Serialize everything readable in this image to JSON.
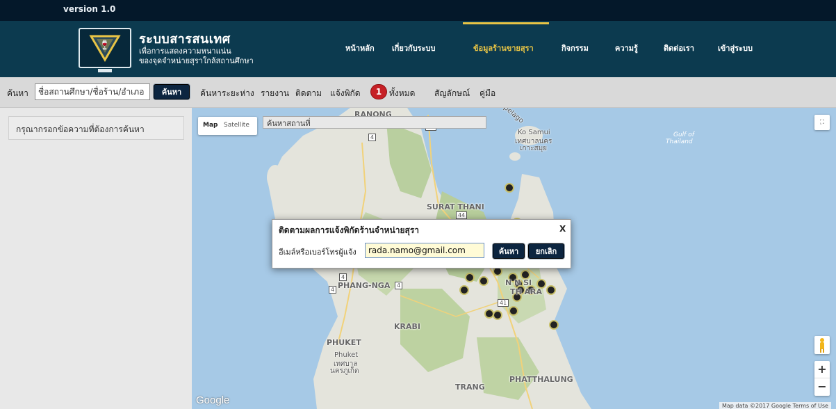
{
  "app": {
    "version": "version 1.0",
    "title": "ระบบสารสนเทศ",
    "subtitle_line1": "เพื่อการแสดงความหนาแน่น",
    "subtitle_line2": "ของจุดจำหน่ายสุราใกล้สถานศึกษา",
    "colors": {
      "header_bg": "#0c3a4f",
      "topbar_bg": "#04182a",
      "accent": "#e8c445",
      "button_dark": "#0c2540",
      "badge_red": "#c62026"
    }
  },
  "nav": {
    "items": [
      {
        "label": "หน้าหลัก",
        "active": false
      },
      {
        "label": "เกี่ยวกับระบบ",
        "active": false
      },
      {
        "label": "ข้อมูลร้านขายสุรา",
        "active": true
      },
      {
        "label": "กิจกรรม",
        "active": false
      },
      {
        "label": "ความรู้",
        "active": false
      },
      {
        "label": "ติดต่อเรา",
        "active": false
      },
      {
        "label": "เข้าสู่ระบบ",
        "active": false
      }
    ]
  },
  "toolbar": {
    "search_label": "ค้นหา",
    "search_value": "ชื่อสถานศึกษา/ชื่อร้าน/อำเภอ",
    "search_button": "ค้นหา",
    "links": [
      "ค้นหาระยะห่าง",
      "รายงาน",
      "ติดตาม",
      "แจ้งพิกัด"
    ],
    "notification_count": "1",
    "all_label": "ทั้งหมด",
    "legend_label": "สัญลักษณ์",
    "manual_label": "คู่มือ"
  },
  "left_panel": {
    "hint": "กรุณากรอกข้อความที่ต้องการค้นหา"
  },
  "map": {
    "type_map": "Map",
    "type_satellite": "Satellite",
    "place_search_value": "ค้นหาสถานที่",
    "labels": {
      "ranong": "RANONG",
      "surat": "SURAT THANI",
      "phangnga": "PHANG-NGA",
      "krabi": "KRABI",
      "phuket": "PHUKET",
      "phuket_city1": "Phuket",
      "phuket_city2": "เทศบาล",
      "phuket_city3": "นครภูเก็ต",
      "trang": "TRANG",
      "phatthalung": "PHATTHALUNG",
      "kosamui1": "Ko Samui",
      "kosamui2": "เทศบาลนคร",
      "kosamui3": "เกาะสมุย",
      "gulf1": "Gulf of",
      "gulf2": "Thailand",
      "nakhon": "N    N SI",
      "thammarat": "TH    ARA",
      "pelago": "pelago"
    },
    "road_shields": [
      "4",
      "41",
      "44",
      "4",
      "4",
      "41",
      "4"
    ],
    "fullscreen_icon": "fullscreen-icon",
    "zoom_in": "+",
    "zoom_out": "−",
    "google": "Google",
    "attribution": "Map data ©2017 Google   Terms of Use"
  },
  "dialog": {
    "title": "ติดตามผลการแจ้งพิกัดร้านจำหน่ายสุรา",
    "close": "X",
    "label": "อีเมล์หรือเบอร์โทรผู้แจ้ง",
    "input_value": "rada.namo@gmail.com",
    "search_button": "ค้นหา",
    "cancel_button": "ยกเลิก"
  }
}
